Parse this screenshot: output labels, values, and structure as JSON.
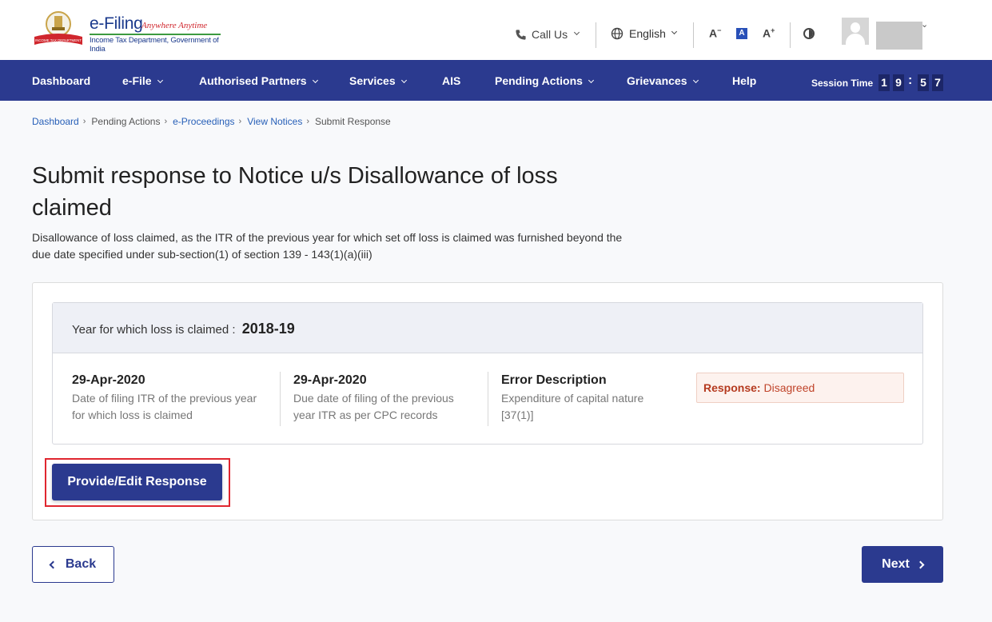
{
  "header": {
    "brand_title": "e-Filing",
    "brand_tagline": "Anywhere Anytime",
    "brand_subtitle": "Income Tax Department, Government of India",
    "emblem_text": "INCOME TAX DEPARTMENT",
    "call_us": "Call Us",
    "language": "English",
    "font_decrease": "A",
    "font_reset": "A",
    "font_increase": "A"
  },
  "nav": {
    "items": [
      "Dashboard",
      "e-File",
      "Authorised Partners",
      "Services",
      "AIS",
      "Pending Actions",
      "Grievances",
      "Help"
    ],
    "session_label": "Session Time",
    "session_digits": [
      "1",
      "9",
      "5",
      "7"
    ]
  },
  "breadcrumb": [
    "Dashboard",
    "Pending Actions",
    "e-Proceedings",
    "View Notices",
    "Submit Response"
  ],
  "page": {
    "title": "Submit response to Notice u/s Disallowance of loss claimed",
    "description": "Disallowance of loss claimed, as the ITR of the previous year for which set off loss is claimed was furnished beyond the due date specified under sub-section(1) of section 139 - 143(1)(a)(iii)"
  },
  "card": {
    "year_label": "Year for which loss is claimed :",
    "year_value": "2018-19",
    "col1_value": "29-Apr-2020",
    "col1_label": "Date of filing ITR of the previous year for which loss is claimed",
    "col2_value": "29-Apr-2020",
    "col2_label": "Due date of filing of the previous year ITR as per CPC records",
    "col3_title": "Error Description",
    "col3_value": "Expenditure of capital nature [37(1)]",
    "response_label": "Response:",
    "response_value": "Disagreed",
    "provide_button": "Provide/Edit Response"
  },
  "footer": {
    "back": "Back",
    "next": "Next"
  },
  "colors": {
    "primary": "#2b3a8f",
    "highlight": "#e0262f",
    "response_text": "#c0442a"
  }
}
